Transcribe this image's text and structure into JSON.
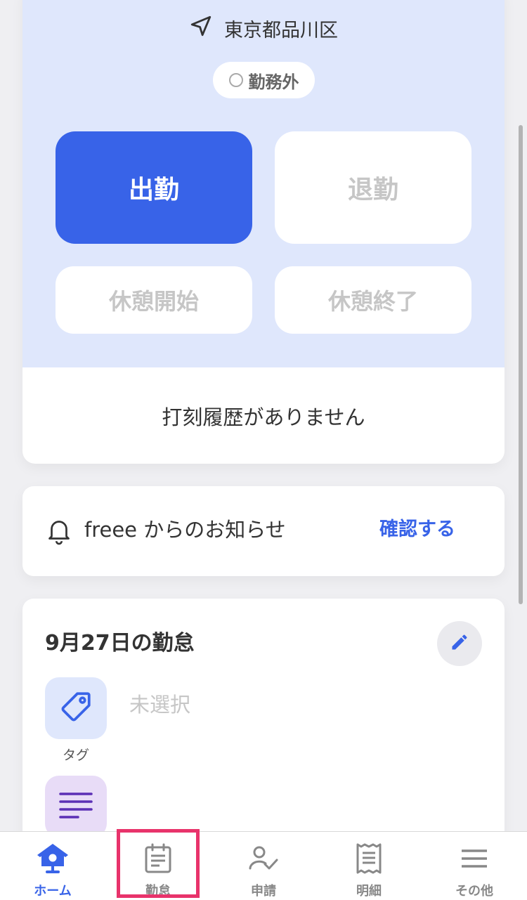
{
  "location": {
    "text": "東京都品川区",
    "icon": "location-arrow-icon"
  },
  "status": {
    "label": "勤務外",
    "icon": "status-circle-icon"
  },
  "punch_buttons": {
    "clock_in": "出勤",
    "clock_out": "退勤",
    "break_start": "休憩開始",
    "break_end": "休憩終了"
  },
  "history": {
    "empty_message": "打刻履歴がありません"
  },
  "notice": {
    "text": "freee からのお知らせ",
    "action": "確認する",
    "icon": "bell-icon"
  },
  "attendance": {
    "title": "9月27日の勤怠",
    "edit_icon": "pencil-icon",
    "tag": {
      "label": "タグ",
      "value": "未選択",
      "icon": "tag-icon"
    },
    "memo": {
      "icon": "memo-lines-icon"
    }
  },
  "nav": {
    "items": [
      {
        "label": "ホーム",
        "icon": "home-birdhouse-icon",
        "active": true
      },
      {
        "label": "勤怠",
        "icon": "calendar-note-icon",
        "active": false
      },
      {
        "label": "申請",
        "icon": "person-check-icon",
        "active": false
      },
      {
        "label": "明細",
        "icon": "receipt-icon",
        "active": false
      },
      {
        "label": "その他",
        "icon": "menu-lines-icon",
        "active": false
      }
    ]
  },
  "colors": {
    "accent": "#3863e8",
    "panel_bg": "#dfe7fc",
    "page_bg": "#efeff2",
    "highlight": "#e8336b",
    "disabled_text": "#c6c6c6"
  }
}
